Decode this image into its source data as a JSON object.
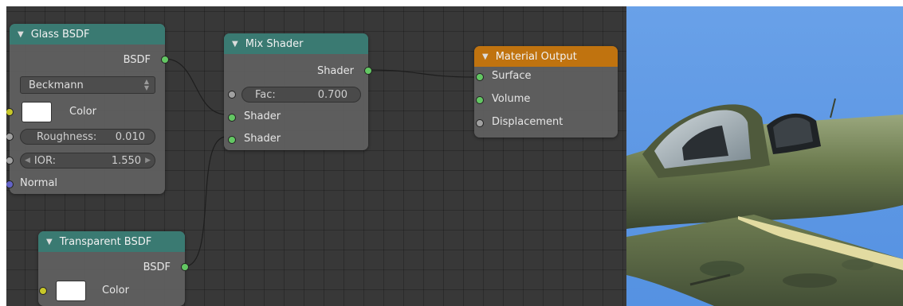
{
  "nodes": {
    "glass_bsdf": {
      "title": "Glass BSDF",
      "output": "BSDF",
      "distribution": "Beckmann",
      "color_label": "Color",
      "roughness_label": "Roughness:",
      "roughness_value": "0.010",
      "ior_label": "IOR:",
      "ior_value": "1.550",
      "normal_label": "Normal"
    },
    "mix_shader": {
      "title": "Mix Shader",
      "output": "Shader",
      "fac_label": "Fac:",
      "fac_value": "0.700",
      "input_1": "Shader",
      "input_2": "Shader"
    },
    "material_output": {
      "title": "Material Output",
      "surface": "Surface",
      "volume": "Volume",
      "displacement": "Displacement"
    },
    "transparent_bsdf": {
      "title": "Transparent BSDF",
      "output": "BSDF",
      "color_label": "Color"
    }
  },
  "colors": {
    "editor_bg": "#383838",
    "node_body": "#606060",
    "shader_header": "#3a7a72",
    "output_header": "#c0730f",
    "shader_socket": "#63c763",
    "color_socket": "#c7c729",
    "value_socket": "#a1a1a1",
    "vector_socket": "#6363c7",
    "sky": "#5d97e4"
  },
  "icons": {
    "collapse": "triangle-down-icon",
    "dropdown": "up-down-arrows-icon",
    "field_arrows": "left-right-arrows-icon"
  }
}
